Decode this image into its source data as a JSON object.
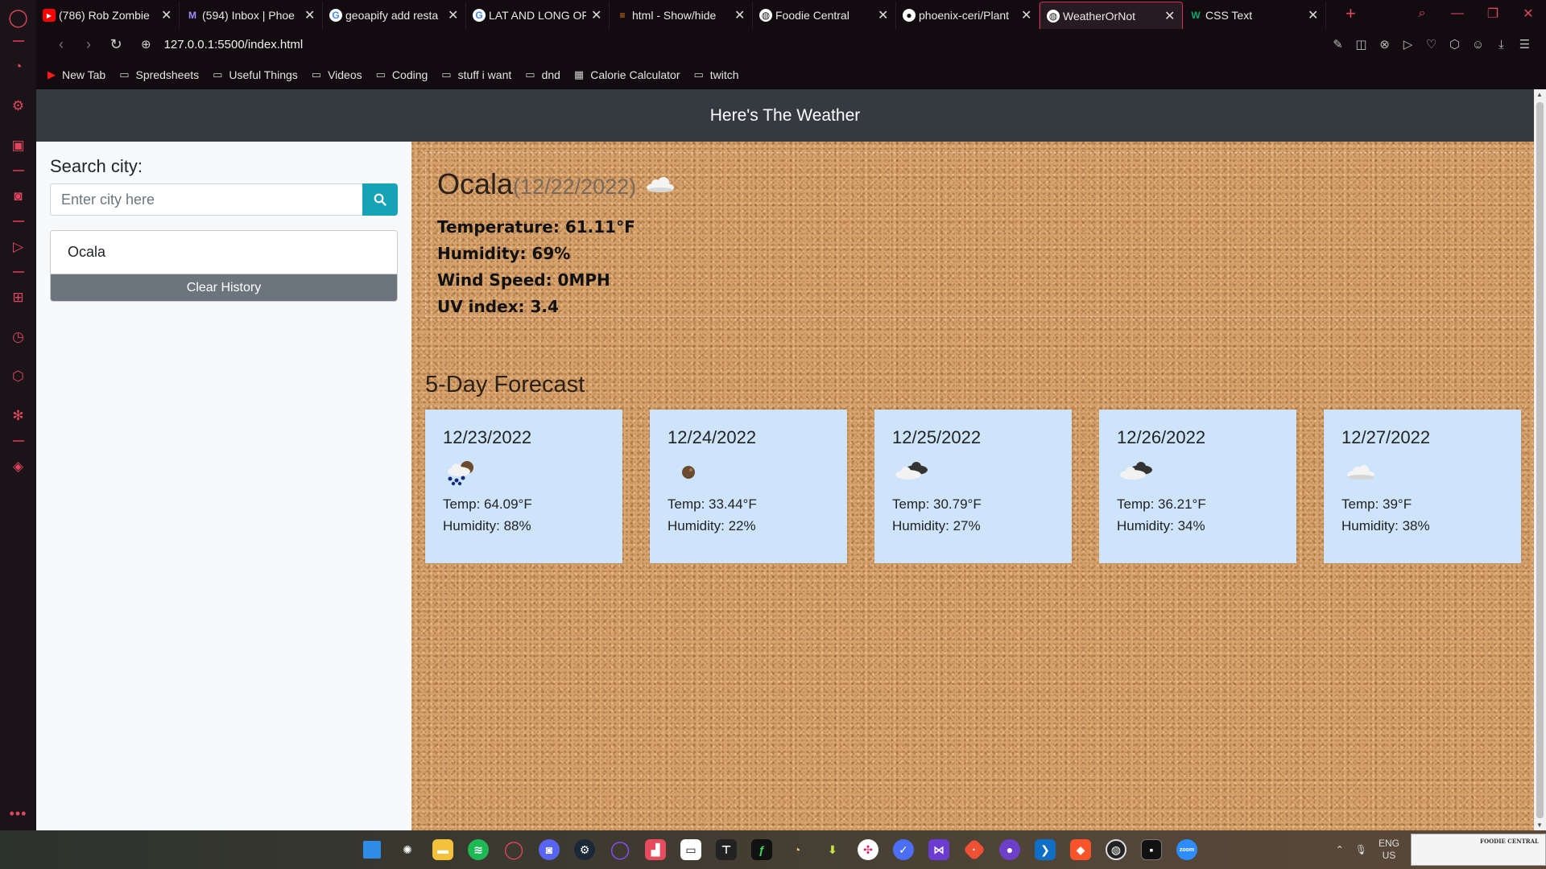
{
  "browser": {
    "tabs": [
      {
        "title": "(786) Rob Zombie",
        "favicon": "youtube-icon",
        "color": "#ff0000"
      },
      {
        "title": "(594) Inbox | Phoe",
        "favicon": "mail-icon",
        "color": "#7b68ee"
      },
      {
        "title": "geoapify add resta",
        "favicon": "google-icon",
        "color": "#ffffff"
      },
      {
        "title": "LAT AND LONG OF",
        "favicon": "google-icon",
        "color": "#ffffff"
      },
      {
        "title": "html - Show/hide",
        "favicon": "stackoverflow-icon",
        "color": "#f48024"
      },
      {
        "title": "Foodie Central",
        "favicon": "globe-icon",
        "color": "#ffffff"
      },
      {
        "title": "phoenix-ceri/Plant",
        "favicon": "github-icon",
        "color": "#ffffff"
      },
      {
        "title": "WeatherOrNot",
        "favicon": "globe-icon",
        "color": "#ffffff",
        "active": true
      },
      {
        "title": "CSS Text",
        "favicon": "w3schools-icon",
        "color": "#04aa6d"
      }
    ],
    "url": "127.0.0.1:5500/index.html",
    "bookmarks": [
      {
        "label": "New Tab",
        "icon": "youtube-icon"
      },
      {
        "label": "Spredsheets",
        "icon": "folder-icon"
      },
      {
        "label": "Useful Things",
        "icon": "folder-icon"
      },
      {
        "label": "Videos",
        "icon": "folder-icon"
      },
      {
        "label": "Coding",
        "icon": "folder-icon"
      },
      {
        "label": "stuff i want",
        "icon": "folder-icon"
      },
      {
        "label": "dnd",
        "icon": "folder-icon"
      },
      {
        "label": "Calorie Calculator",
        "icon": "calculator-icon"
      },
      {
        "label": "twitch",
        "icon": "folder-icon"
      }
    ],
    "accent": "#e0455f"
  },
  "app": {
    "header_title": "Here's The Weather",
    "search": {
      "label": "Search city:",
      "placeholder": "Enter city here",
      "button_icon": "search-icon",
      "button_color": "#17a2b8"
    },
    "history": [
      {
        "city": "Ocala"
      }
    ],
    "clear_label": "Clear History",
    "current": {
      "city": "Ocala",
      "date": "(12/22/2022)",
      "icon": "cloud-icon",
      "temperature": "Temperature: 61.11°F",
      "humidity": "Humidity: 69%",
      "wind": "Wind Speed: 0MPH",
      "uv": "UV index: 3.4"
    },
    "forecast_title": "5-Day Forecast",
    "forecast": [
      {
        "date": "12/23/2022",
        "icon": "rain-cloud-icon",
        "temp": "Temp: 64.09°F",
        "humidity": "Humidity: 88%"
      },
      {
        "date": "12/24/2022",
        "icon": "clear-night-icon",
        "temp": "Temp: 33.44°F",
        "humidity": "Humidity: 22%"
      },
      {
        "date": "12/25/2022",
        "icon": "broken-clouds-icon",
        "temp": "Temp: 30.79°F",
        "humidity": "Humidity: 27%"
      },
      {
        "date": "12/26/2022",
        "icon": "broken-clouds-icon",
        "temp": "Temp: 36.21°F",
        "humidity": "Humidity: 34%"
      },
      {
        "date": "12/27/2022",
        "icon": "cloud-icon",
        "temp": "Temp: 39°F",
        "humidity": "Humidity: 38%"
      }
    ]
  },
  "taskbar": {
    "tray_lang": "ENG",
    "tray_region": "US",
    "preview_title": "FOODIE CENTRAL"
  }
}
